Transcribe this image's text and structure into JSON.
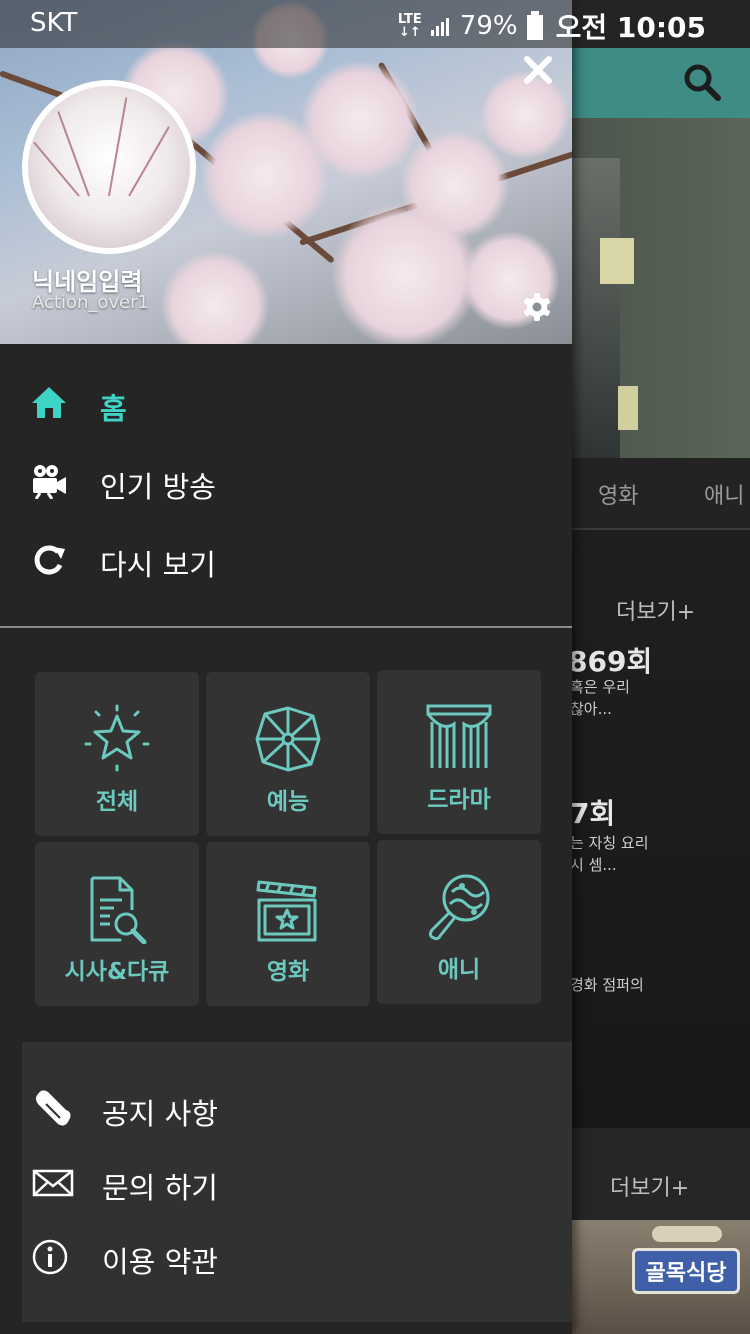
{
  "status_bar": {
    "carrier": "SKT",
    "network": "LTE",
    "battery": "79%",
    "time": "오전 10:05"
  },
  "drawer": {
    "profile": {
      "nickname": "닉네임입력",
      "user_id": "Action_over1"
    },
    "nav": [
      {
        "label": "홈",
        "icon": "home-icon",
        "active": true
      },
      {
        "label": "인기 방송",
        "icon": "movie-camera-icon",
        "active": false
      },
      {
        "label": "다시 보기",
        "icon": "replay-icon",
        "active": false
      }
    ],
    "categories": [
      {
        "label": "전체",
        "icon": "star-icon"
      },
      {
        "label": "예능",
        "icon": "pinwheel-icon"
      },
      {
        "label": "드라마",
        "icon": "curtain-icon"
      },
      {
        "label": "시사&다큐",
        "icon": "document-search-icon"
      },
      {
        "label": "영화",
        "icon": "clapperboard-icon"
      },
      {
        "label": "애니",
        "icon": "maracas-icon"
      }
    ],
    "bottom_menu": [
      {
        "label": "공지 사항",
        "icon": "megaphone-icon"
      },
      {
        "label": "문의 하기",
        "icon": "envelope-icon"
      },
      {
        "label": "이용 약관",
        "icon": "info-icon"
      }
    ],
    "accent_color": "#3fd3c6",
    "category_color": "#6cc9bf"
  },
  "background": {
    "tabs": [
      "영화",
      "애니"
    ],
    "more_label": "더보기+",
    "episodes": [
      {
        "title": "869회",
        "desc_line1": "혹은 우리",
        "desc_line2": "찮아..."
      },
      {
        "title": "7회",
        "desc_line1": "는 자칭 요리",
        "desc_line2": "시 셈..."
      }
    ],
    "caption": "경화 점퍼의",
    "thumbnail_title": "골목식당",
    "topbar_color": "#3e8c84"
  }
}
